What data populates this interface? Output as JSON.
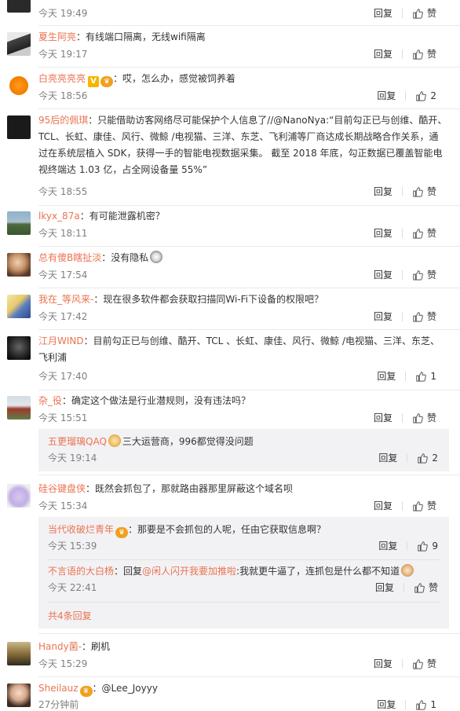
{
  "actions": {
    "reply": "回复",
    "like": "赞"
  },
  "comments": [
    {
      "user": "",
      "text": "",
      "time": "今天 19:49",
      "like": "赞"
    },
    {
      "user": "夏生阿亮",
      "text": "：有线端口隔离，无线wifi隔离",
      "time": "今天 19:17",
      "like": "赞"
    },
    {
      "user": "白亮亮亮亮",
      "text": "：哎，怎么办，感觉被饲养着",
      "time": "今天 18:56",
      "like": "2"
    },
    {
      "user": "95后的佩琪",
      "text_l1": "：只能借助访客网络尽可能保护个人信息了//@NanoNya:“目前勾正已与创维、酷开、",
      "text_l2": "TCL、长虹、康佳、风行、微鲸 /电视猫、三洋、东芝、飞利浦等厂商达成长期战略合作关系，通",
      "text_l3": "过在系统层植入 SDK，获得一手的智能电视数据采集。 截至 2018 年底，勾正数据已覆盖智能电",
      "text_l4": "视终端达 1.03 亿，占全网设备量 55%”",
      "time": "今天 18:55",
      "like": "赞"
    },
    {
      "user": "lkyx_87a",
      "text": "：有可能泄露机密？",
      "time": "今天 18:11",
      "like": "赞"
    },
    {
      "user": "总有傻B瞎扯淡",
      "text": "：没有隐私",
      "time": "今天 17:54",
      "like": "赞"
    },
    {
      "user": "我在_等风来-",
      "text": "：现在很多软件都会获取扫描同Wi-Fi下设备的权限吧？",
      "time": "今天 17:42",
      "like": "赞"
    },
    {
      "user": "江月WIND",
      "text_l1": "：目前勾正已与创维、酷开、TCL 、长虹、康佳、风行、微鲸 /电视猫、三洋、东芝、",
      "text_l2": "飞利浦",
      "time": "今天 17:40",
      "like": "1"
    },
    {
      "user": "杂_役",
      "text": "：确定这个做法是行业潜规则，没有违法吗？",
      "time": "今天 15:51",
      "like": "赞"
    },
    {
      "user": "硅谷键盘侠",
      "text": "：既然会抓包了，那就路由器那里屏蔽这个域名呗",
      "time": "今天 15:34",
      "like": "赞"
    },
    {
      "user": "Handy菌-",
      "text": "：刷机",
      "time": "今天 15:29",
      "like": "赞"
    },
    {
      "user": "Sheilauz",
      "text": "：@Lee_Joyyy",
      "time": "27分钟前",
      "like": "1"
    }
  ],
  "subs": {
    "s1": {
      "user": "五更瑠璃QAQ",
      "text": "三大运营商，996都觉得没问题",
      "time": "今天 19:14",
      "like": "2"
    },
    "s2": {
      "user": "当代收破烂青年",
      "text": "：那要是不会抓包的人呢，任由它获取信息啊？",
      "time": "今天 15:39",
      "like": "9"
    },
    "s3": {
      "user": "不言语的大白杨",
      "text_a": "：回复",
      "mention": "@闲人闪开我要加推啦",
      "text_b": ":我就更牛逼了，连抓包是什么都不知道",
      "time": "今天 22:41",
      "like": "赞"
    },
    "more": "共4条回复"
  },
  "colors": {
    "username": "#eb7350",
    "time": "#808080",
    "subbox": "#f2f2f5"
  }
}
